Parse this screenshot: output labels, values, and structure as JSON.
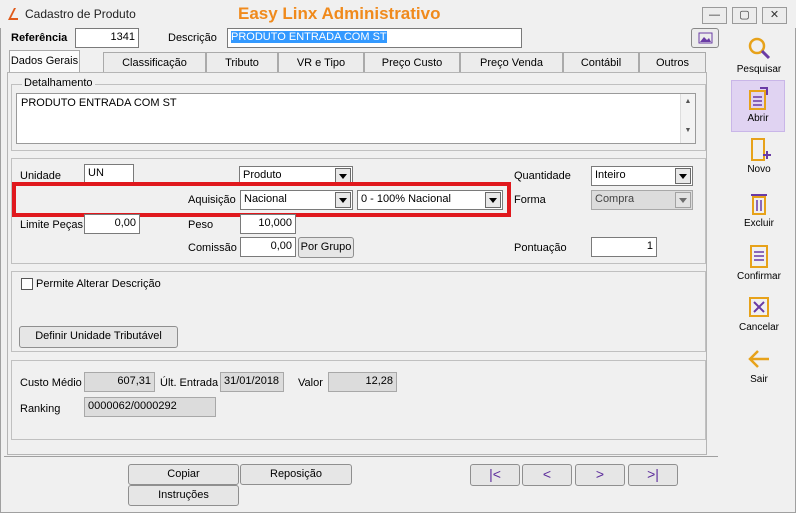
{
  "window": {
    "title": "Cadastro de Produto",
    "app_title": "Easy Linx Administrativo"
  },
  "header": {
    "ref_label": "Referência",
    "ref_value": "1341",
    "desc_label": "Descrição",
    "desc_value": "PRODUTO ENTRADA COM ST"
  },
  "tabs": [
    "Dados Gerais",
    "Classificação",
    "Tributo",
    "VR e Tipo",
    "Preço Custo",
    "Preço Venda",
    "Contábil",
    "Outros"
  ],
  "detail": {
    "label": "Detalhamento",
    "text": "PRODUTO ENTRADA COM ST"
  },
  "fields": {
    "unidade_label": "Unidade",
    "unidade_value": "UN",
    "tipo_value": "Produto",
    "quantidade_label": "Quantidade",
    "quantidade_value": "Inteiro",
    "aquisicao_label": "Aquisição",
    "aquisicao_value": "Nacional",
    "origem_value": "0 - 100% Nacional",
    "forma_label": "Forma",
    "forma_value": "Compra",
    "limite_label": "Limite Peças",
    "limite_value": "0,00",
    "peso_label": "Peso",
    "peso_value": "10,000",
    "comissao_label": "Comissão",
    "comissao_value": "0,00",
    "por_grupo": "Por Grupo",
    "pontuacao_label": "Pontuação",
    "pontuacao_value": "1"
  },
  "options": {
    "permite_label": "Permite Alterar Descrição",
    "definir_button": "Definir Unidade Tributável"
  },
  "costs": {
    "custo_label": "Custo Médio",
    "custo_value": "607,31",
    "ult_label": "Últ. Entrada",
    "ult_value": "31/01/2018",
    "valor_label": "Valor",
    "valor_value": "12,28",
    "ranking_label": "Ranking",
    "ranking_value": "0000062/0000292"
  },
  "bottom": {
    "copiar": "Copiar",
    "reposicao": "Reposição",
    "instrucoes": "Instruções"
  },
  "sidebar": [
    {
      "label": "Pesquisar",
      "icon": "search-icon"
    },
    {
      "label": "Abrir",
      "icon": "open-icon"
    },
    {
      "label": "Novo",
      "icon": "new-icon"
    },
    {
      "label": "Excluir",
      "icon": "delete-icon"
    },
    {
      "label": "Confirmar",
      "icon": "confirm-icon"
    },
    {
      "label": "Cancelar",
      "icon": "cancel-icon"
    },
    {
      "label": "Sair",
      "icon": "exit-icon"
    }
  ],
  "colors": {
    "accent": "#f08a1c",
    "highlight_border": "#e0181d",
    "selection": "#3399ff",
    "icon_orange": "#e7a21a",
    "icon_purple": "#6a3ba5"
  }
}
